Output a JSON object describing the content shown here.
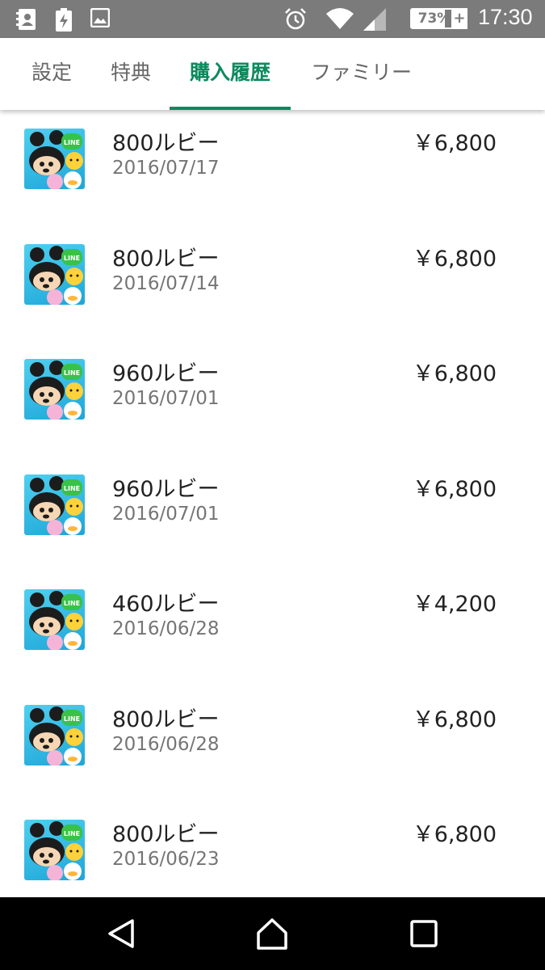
{
  "status_bar": {
    "battery_percent": "73%",
    "battery_level": 0.73,
    "charging_plus": "+",
    "time": "17:30",
    "icons": [
      "contacts-icon",
      "battery-saver-icon",
      "image-icon",
      "alarm-icon",
      "wifi-icon",
      "cell-signal-icon",
      "battery-icon"
    ]
  },
  "tabs": [
    {
      "label": "設定",
      "active": false
    },
    {
      "label": "特典",
      "active": false
    },
    {
      "label": "購入履歴",
      "active": true
    },
    {
      "label": "ファミリー",
      "active": false
    }
  ],
  "colors": {
    "accent": "#0b8a5e",
    "status_bar": "#7b7b7b",
    "nav_bar": "#000000",
    "app_icon_bg": "#1ea6d8"
  },
  "purchases": [
    {
      "item": "800ルビー",
      "date": "2016/07/17",
      "price": "￥6,800",
      "icon": "tsum-tsum-app-icon"
    },
    {
      "item": "800ルビー",
      "date": "2016/07/14",
      "price": "￥6,800",
      "icon": "tsum-tsum-app-icon"
    },
    {
      "item": "960ルビー",
      "date": "2016/07/01",
      "price": "￥6,800",
      "icon": "tsum-tsum-app-icon"
    },
    {
      "item": "960ルビー",
      "date": "2016/07/01",
      "price": "￥6,800",
      "icon": "tsum-tsum-app-icon"
    },
    {
      "item": "460ルビー",
      "date": "2016/06/28",
      "price": "￥4,200",
      "icon": "tsum-tsum-app-icon"
    },
    {
      "item": "800ルビー",
      "date": "2016/06/28",
      "price": "￥6,800",
      "icon": "tsum-tsum-app-icon"
    },
    {
      "item": "800ルビー",
      "date": "2016/06/23",
      "price": "￥6,800",
      "icon": "tsum-tsum-app-icon"
    }
  ],
  "nav_bar": {
    "icons": [
      "back-icon",
      "home-icon",
      "recent-apps-icon"
    ]
  }
}
